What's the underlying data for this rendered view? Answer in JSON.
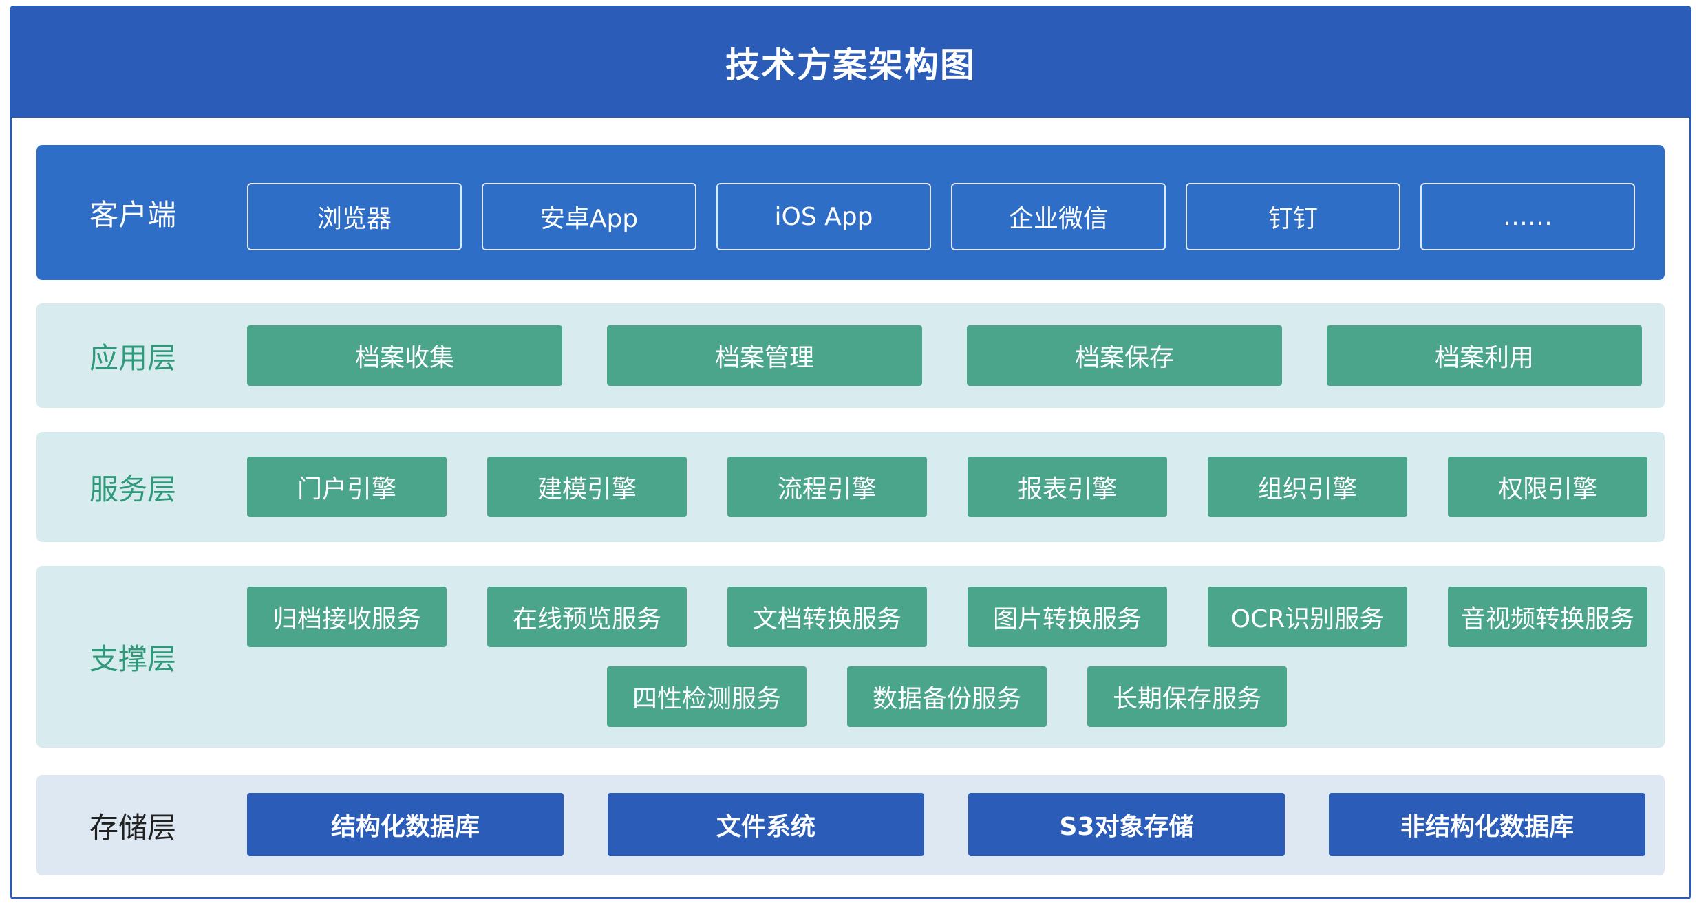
{
  "title": "技术方案架构图",
  "layers": {
    "client": {
      "label": "客户端",
      "items": [
        "浏览器",
        "安卓App",
        "iOS App",
        "企业微信",
        "钉钉",
        "……"
      ]
    },
    "application": {
      "label": "应用层",
      "items": [
        "档案收集",
        "档案管理",
        "档案保存",
        "档案利用"
      ]
    },
    "service": {
      "label": "服务层",
      "items": [
        "门户引擎",
        "建模引擎",
        "流程引擎",
        "报表引擎",
        "组织引擎",
        "权限引擎"
      ]
    },
    "support": {
      "label": "支撑层",
      "items": [
        "归档接收服务",
        "在线预览服务",
        "文档转换服务",
        "图片转换服务",
        "OCR识别服务",
        "音视频转换服务",
        "四性检测服务",
        "数据备份服务",
        "长期保存服务"
      ]
    },
    "storage": {
      "label": "存储层",
      "items": [
        "结构化数据库",
        "文件系统",
        "S3对象存储",
        "非结构化数据库"
      ]
    }
  },
  "colors": {
    "header_blue": "#2a5cb8",
    "client_blue": "#2f6ec7",
    "teal_box": "#4aa58b",
    "teal_text": "#2e9a7a",
    "light_panel": "#d8ebee",
    "storage_panel": "#dde8f2"
  }
}
